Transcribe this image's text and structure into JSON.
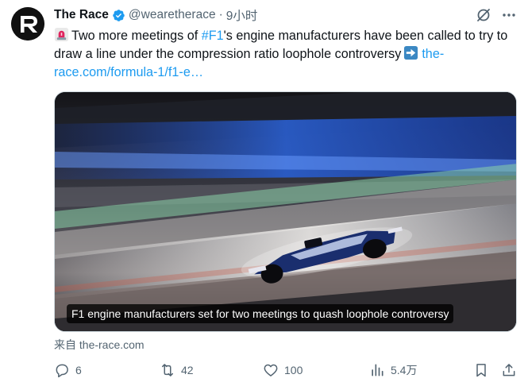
{
  "author": {
    "name": "The Race",
    "handle": "@wearetherace",
    "separator": "·",
    "time": "9小时",
    "avatar_icon": "the-race-logo-r",
    "verified_icon": "verified-badge-icon"
  },
  "tweet": {
    "emoji_icon": "police-siren-emoji",
    "text_part1": "Two more meetings of ",
    "hashtag": "#F1",
    "text_part2": "'s engine manufacturers have been called to try to draw a line under the compression ratio loophole controversy",
    "arrow_icon": "right-arrow-emoji",
    "link": "the-race.com/formula-1/f1-e…"
  },
  "card": {
    "caption": "F1 engine manufacturers set for two meetings to quash loophole controversy",
    "source": "来自 the-race.com"
  },
  "actions": {
    "replies": "6",
    "retweets": "42",
    "likes": "100",
    "views": "5.4万"
  },
  "colors": {
    "link": "#1d9bf0",
    "text": "#0f1419",
    "secondary": "#536471",
    "verified": "#1d9bf0"
  }
}
